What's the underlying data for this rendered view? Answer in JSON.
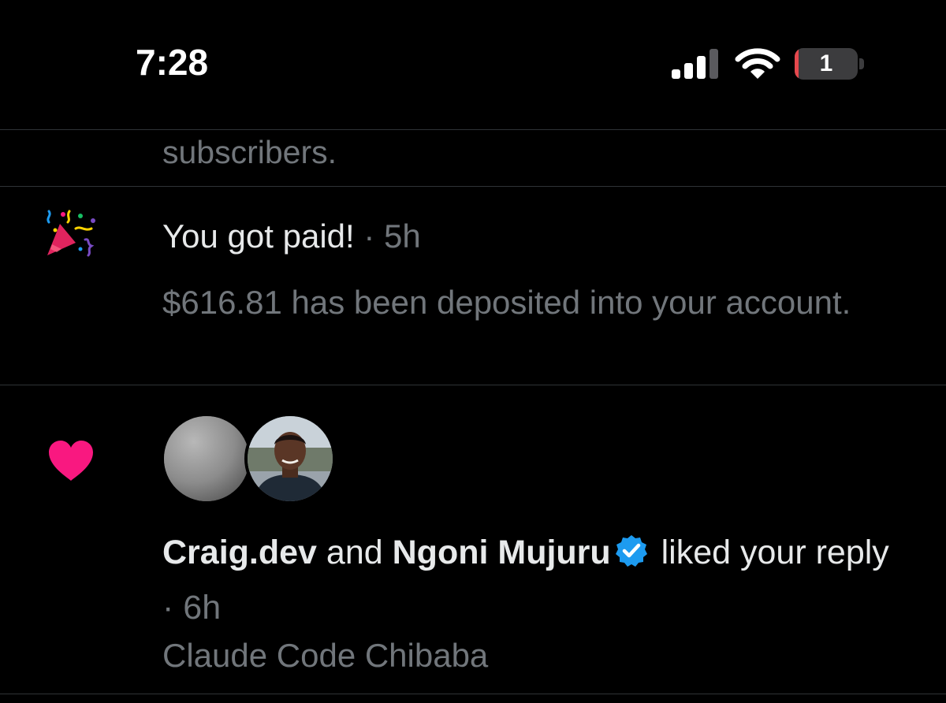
{
  "status_bar": {
    "time": "7:28",
    "battery_level": "1",
    "signal_icon": "cellular-signal-icon",
    "wifi_icon": "wifi-icon",
    "battery_icon": "battery-icon"
  },
  "notifications": [
    {
      "type": "partial",
      "text": "subscribers."
    },
    {
      "type": "payout",
      "icon": "party-popper-icon",
      "title": "You got paid!",
      "separator": "·",
      "time": "5h",
      "body": "$616.81 has been deposited into your account."
    },
    {
      "type": "like",
      "icon": "heart-icon",
      "user1": "Craig.dev",
      "connector": "and",
      "user2": "Ngoni Mujuru",
      "verified_icon": "verified-badge-icon",
      "action": "liked your reply",
      "separator": "·",
      "time": "6h",
      "excerpt": "Claude Code Chibaba"
    }
  ],
  "colors": {
    "background": "#000000",
    "primary_text": "#e7e9ea",
    "secondary_text": "#71767b",
    "divider": "#2f3336",
    "heart": "#f91880",
    "verified": "#1d9bf0",
    "battery_low": "#e5484d"
  }
}
